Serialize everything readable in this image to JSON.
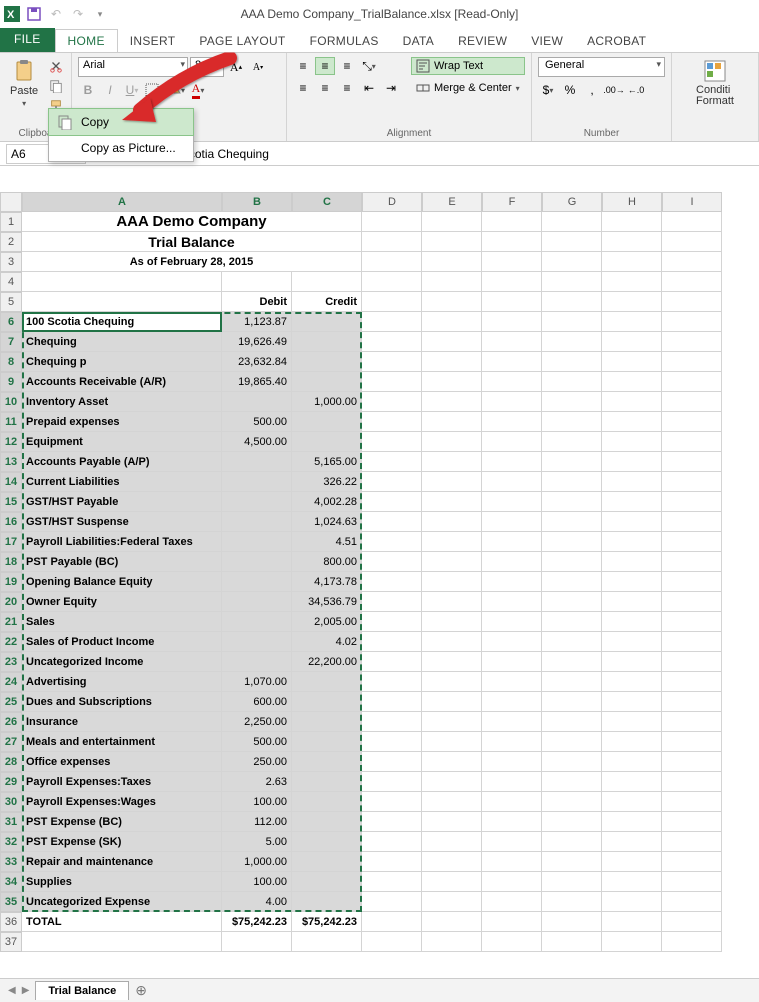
{
  "titlebar": {
    "title": "AAA Demo Company_TrialBalance.xlsx  [Read-Only]"
  },
  "tabs": {
    "file": "FILE",
    "home": "HOME",
    "insert": "INSERT",
    "pagelayout": "PAGE LAYOUT",
    "formulas": "FORMULAS",
    "data": "DATA",
    "review": "REVIEW",
    "view": "VIEW",
    "acrobat": "ACROBAT"
  },
  "ribbon": {
    "clipboard": {
      "paste": "Paste",
      "label": "Clipboa"
    },
    "font": {
      "name": "Arial",
      "size": "8",
      "label": ""
    },
    "alignment": {
      "wrap": "Wrap Text",
      "merge": "Merge & Center",
      "label": "Alignment"
    },
    "number": {
      "format": "General",
      "label": "Number"
    },
    "styles": {
      "cond": "Conditi\nFormatt"
    }
  },
  "context_menu": {
    "copy": "Copy",
    "copy_picture": "Copy as Picture..."
  },
  "formula": {
    "namebox": "A6",
    "value": "100 Scotia Chequing"
  },
  "columns": [
    "A",
    "B",
    "C",
    "D",
    "E",
    "F",
    "G",
    "H",
    "I"
  ],
  "report": {
    "title": "AAA Demo Company",
    "subtitle": "Trial Balance",
    "asof": "As of February 28, 2015",
    "debit_hdr": "Debit",
    "credit_hdr": "Credit",
    "total_label": "TOTAL",
    "total_debit": "$75,242.23",
    "total_credit": "$75,242.23"
  },
  "rows": [
    {
      "n": 6,
      "a": "100 Scotia Chequing",
      "b": "1,123.87",
      "c": ""
    },
    {
      "n": 7,
      "a": "Chequing",
      "b": "19,626.49",
      "c": ""
    },
    {
      "n": 8,
      "a": "Chequing p",
      "b": "23,632.84",
      "c": ""
    },
    {
      "n": 9,
      "a": "Accounts Receivable (A/R)",
      "b": "19,865.40",
      "c": ""
    },
    {
      "n": 10,
      "a": "Inventory Asset",
      "b": "",
      "c": "1,000.00"
    },
    {
      "n": 11,
      "a": "Prepaid expenses",
      "b": "500.00",
      "c": ""
    },
    {
      "n": 12,
      "a": "Equipment",
      "b": "4,500.00",
      "c": ""
    },
    {
      "n": 13,
      "a": "Accounts Payable (A/P)",
      "b": "",
      "c": "5,165.00"
    },
    {
      "n": 14,
      "a": "Current Liabilities",
      "b": "",
      "c": "326.22"
    },
    {
      "n": 15,
      "a": "GST/HST Payable",
      "b": "",
      "c": "4,002.28"
    },
    {
      "n": 16,
      "a": "GST/HST Suspense",
      "b": "",
      "c": "1,024.63"
    },
    {
      "n": 17,
      "a": "Payroll Liabilities:Federal Taxes",
      "b": "",
      "c": "4.51"
    },
    {
      "n": 18,
      "a": "PST Payable (BC)",
      "b": "",
      "c": "800.00"
    },
    {
      "n": 19,
      "a": "Opening Balance Equity",
      "b": "",
      "c": "4,173.78"
    },
    {
      "n": 20,
      "a": "Owner Equity",
      "b": "",
      "c": "34,536.79"
    },
    {
      "n": 21,
      "a": "Sales",
      "b": "",
      "c": "2,005.00"
    },
    {
      "n": 22,
      "a": "Sales of Product Income",
      "b": "",
      "c": "4.02"
    },
    {
      "n": 23,
      "a": "Uncategorized Income",
      "b": "",
      "c": "22,200.00"
    },
    {
      "n": 24,
      "a": "Advertising",
      "b": "1,070.00",
      "c": ""
    },
    {
      "n": 25,
      "a": "Dues and Subscriptions",
      "b": "600.00",
      "c": ""
    },
    {
      "n": 26,
      "a": "Insurance",
      "b": "2,250.00",
      "c": ""
    },
    {
      "n": 27,
      "a": "Meals and entertainment",
      "b": "500.00",
      "c": ""
    },
    {
      "n": 28,
      "a": "Office expenses",
      "b": "250.00",
      "c": ""
    },
    {
      "n": 29,
      "a": "Payroll Expenses:Taxes",
      "b": "2.63",
      "c": ""
    },
    {
      "n": 30,
      "a": "Payroll Expenses:Wages",
      "b": "100.00",
      "c": ""
    },
    {
      "n": 31,
      "a": "PST Expense (BC)",
      "b": "112.00",
      "c": ""
    },
    {
      "n": 32,
      "a": "PST Expense (SK)",
      "b": "5.00",
      "c": ""
    },
    {
      "n": 33,
      "a": "Repair and maintenance",
      "b": "1,000.00",
      "c": ""
    },
    {
      "n": 34,
      "a": "Supplies",
      "b": "100.00",
      "c": ""
    },
    {
      "n": 35,
      "a": "Uncategorized Expense",
      "b": "4.00",
      "c": ""
    }
  ],
  "sheet": {
    "name": "Trial Balance"
  }
}
